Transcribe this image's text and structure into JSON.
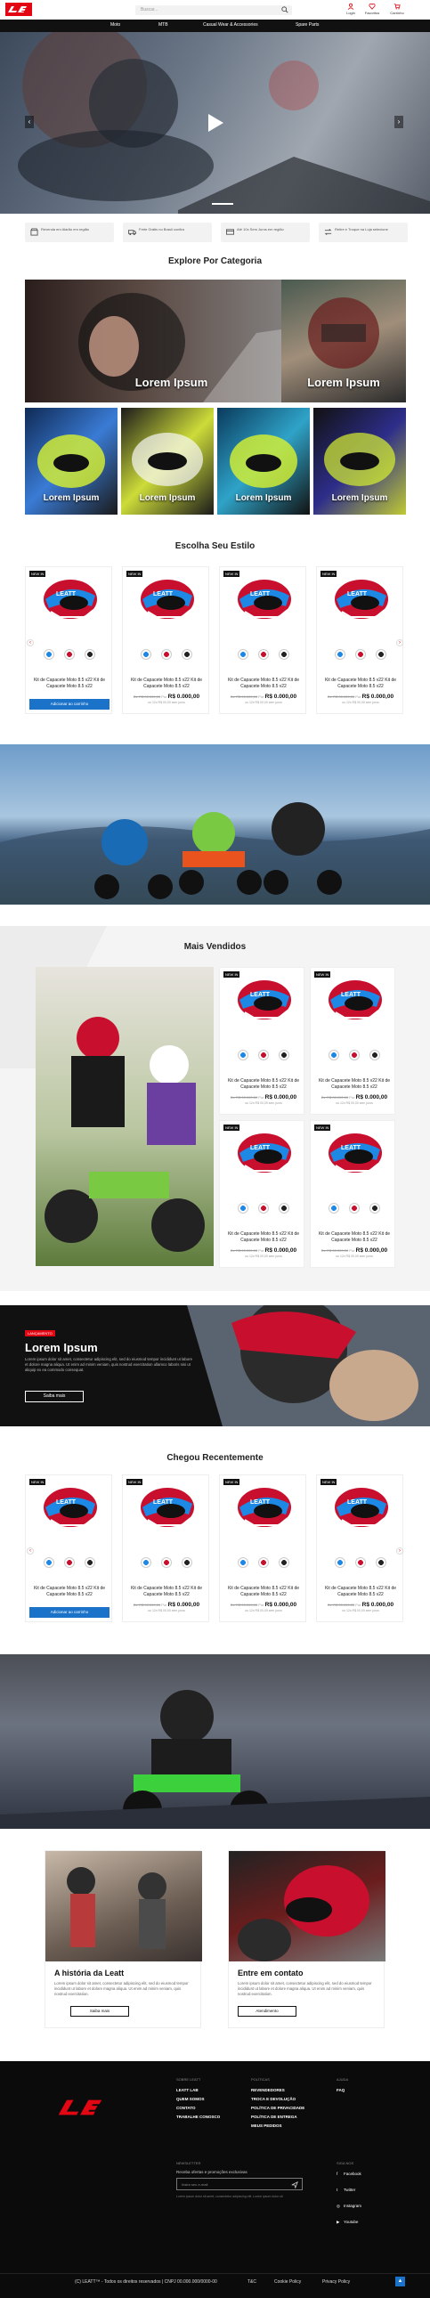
{
  "header": {
    "search_placeholder": "Buscar...",
    "icons": [
      {
        "label": "Login",
        "icon": "user-icon"
      },
      {
        "label": "Favoritos",
        "icon": "heart-icon"
      },
      {
        "label": "Carrinho",
        "icon": "cart-icon"
      }
    ]
  },
  "nav": [
    "Moto",
    "MTB",
    "Casual Wear & Accessories",
    "Spare Parts"
  ],
  "features": [
    "Revenda em Alarão em região",
    "Frete Grátis no Brasil confira",
    "Até 10x Sem Juros em região",
    "Retire e Troque na Loja selecione"
  ],
  "explore": {
    "title": "Explore Por Categoria",
    "big": [
      "Lorem Ipsum",
      "Lorem Ipsum"
    ],
    "small": [
      "Lorem Ipsum",
      "Lorem Ipsum",
      "Lorem Ipsum",
      "Lorem Ipsum"
    ]
  },
  "style": {
    "title": "Escolha Seu Estilo"
  },
  "product": {
    "badge": "NEW IN",
    "title": "Kit de Capacete Moto 8.5 v22 Kit de Capacete Moto 8.5 v22",
    "old_price": "De R$ 00.000,00",
    "price_prefix": "Por",
    "price": "R$ 0.000,00",
    "installments": "ou 12x R$ 00,00 sem juros",
    "add_to_cart": "Adicionar ao carrinho"
  },
  "bestsellers": {
    "title": "Mais Vendidos"
  },
  "promo": {
    "tag": "LANÇAMENTO",
    "title": "Lorem Ipsum",
    "text": "Lorem ipsum dolor sit amet, consectetur adipiscing elit, sed do eiusmod tempor incididunt ut labore et dolore magna aliqua. Ut enim ad minim veniam, quis nostrud exercitation ullamco laboris nisi ut aliquip ex ea commodo consequat.",
    "button": "Saiba mais"
  },
  "recent": {
    "title": "Chegou Recentemente"
  },
  "stories": [
    {
      "title": "A história da Leatt",
      "text": "Lorem ipsum dolor sit amet, consectetur adipiscing elit, sed do eiusmod tempor incididunt ut labore et dolore magna aliqua. Ut enim ad minim veniam, quis nostrud exercitation.",
      "button": "Saiba mais"
    },
    {
      "title": "Entre em contato",
      "text": "Lorem ipsum dolor sit amet, consectetur adipiscing elit, sed do eiusmod tempor incididunt ut labore et dolore magna aliqua. Ut enim ad minim veniam, quis nostrud exercitation.",
      "button": "Atendimento"
    }
  ],
  "footer": {
    "col1": {
      "heading": "SOBRE LEATT",
      "links": [
        "LEATT LAB",
        "QUEM SOMOS",
        "CONTATO",
        "TRABALHE CONOSCO"
      ]
    },
    "col2": {
      "heading": "POLÍTICAS",
      "links": [
        "REVENDEDORES",
        "TROCA E DEVOLUÇÃO",
        "POLÍTICA DE PRIVACIDADE",
        "POLÍTICA DE ENTREGA",
        "MEUS PEDIDOS"
      ]
    },
    "col3": {
      "heading": "AJUDA",
      "links": [
        "FAQ"
      ]
    },
    "newsletter": {
      "heading": "NEWSLETTER",
      "text": "Receba ofertas e promoções exclusivas",
      "placeholder": "Insira seu e-mail",
      "note": "Lorem ipsum dolor sit amet, consectetur adipiscing elit. Lorem ipsum dolor sit"
    },
    "social": {
      "heading": "SIGA NOS",
      "items": [
        "Facebook",
        "Twitter",
        "Instagram",
        "Youtube"
      ]
    },
    "copyright": "(C) LEATT™ - Todos os direitos reservados | CNPJ 00.000.000/0000-00",
    "bottom_links": [
      "T&C",
      "Cookie Policy",
      "Privacy Policy"
    ]
  },
  "colors": {
    "brand": "#e30613",
    "dark": "#111111",
    "blue": "#1a73c9"
  }
}
